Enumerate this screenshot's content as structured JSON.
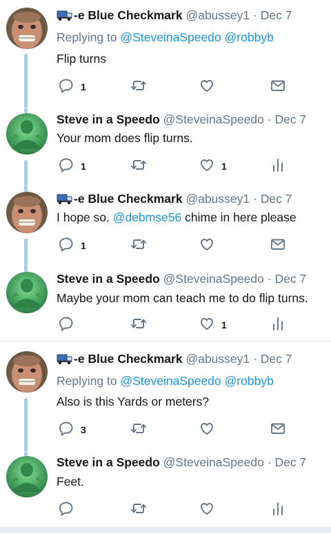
{
  "colors": {
    "link": "#1b95e0",
    "icon": "#657786",
    "thread": "#9dd2ea",
    "divider": "#e1e8ed"
  },
  "tweets": [
    {
      "id": "t1",
      "author": "abussey1",
      "name": "-e Blue Checkmark",
      "handle": "@abussey1",
      "dot": "·",
      "date": "Dec 7",
      "replying_prefix": "Replying to",
      "replying_to": [
        "@SteveinaSpeedo",
        "@robbyb"
      ],
      "text": "Flip turns",
      "replies": "1",
      "retweets": "",
      "likes": "",
      "last_action": "direct-message"
    },
    {
      "id": "t2",
      "author": "SteveinaSpeedo",
      "name": "Steve in a Speedo",
      "handle": "@SteveinaSpeedo",
      "dot": "·",
      "date": "Dec 7",
      "text": "Your mom does flip turns.",
      "replies": "1",
      "retweets": "",
      "likes": "1",
      "last_action": "analytics"
    },
    {
      "id": "t3",
      "author": "abussey1",
      "name": "-e Blue Checkmark",
      "handle": "@abussey1",
      "dot": "·",
      "date": "Dec 7",
      "text_before": "I hope so.",
      "text_mention": "@debmse56",
      "text_after": "chime in here please",
      "replies": "1",
      "retweets": "",
      "likes": "",
      "last_action": "direct-message"
    },
    {
      "id": "t4",
      "author": "SteveinaSpeedo",
      "name": "Steve in a Speedo",
      "handle": "@SteveinaSpeedo",
      "dot": "·",
      "date": "Dec 7",
      "text": "Maybe your mom can teach me to do flip turns.",
      "replies": "",
      "retweets": "",
      "likes": "1",
      "last_action": "analytics"
    },
    {
      "id": "t5",
      "author": "abussey1",
      "name": "-e Blue Checkmark",
      "handle": "@abussey1",
      "dot": "·",
      "date": "Dec 7",
      "replying_prefix": "Replying to",
      "replying_to": [
        "@SteveinaSpeedo",
        "@robbyb"
      ],
      "text": "Also is this Yards or meters?",
      "replies": "3",
      "retweets": "",
      "likes": "",
      "last_action": "direct-message"
    },
    {
      "id": "t6",
      "author": "SteveinaSpeedo",
      "name": "Steve in a Speedo",
      "handle": "@SteveinaSpeedo",
      "dot": "·",
      "date": "Dec 7",
      "text": "Feet.",
      "replies": "",
      "retweets": "",
      "likes": "",
      "last_action": "analytics"
    }
  ]
}
